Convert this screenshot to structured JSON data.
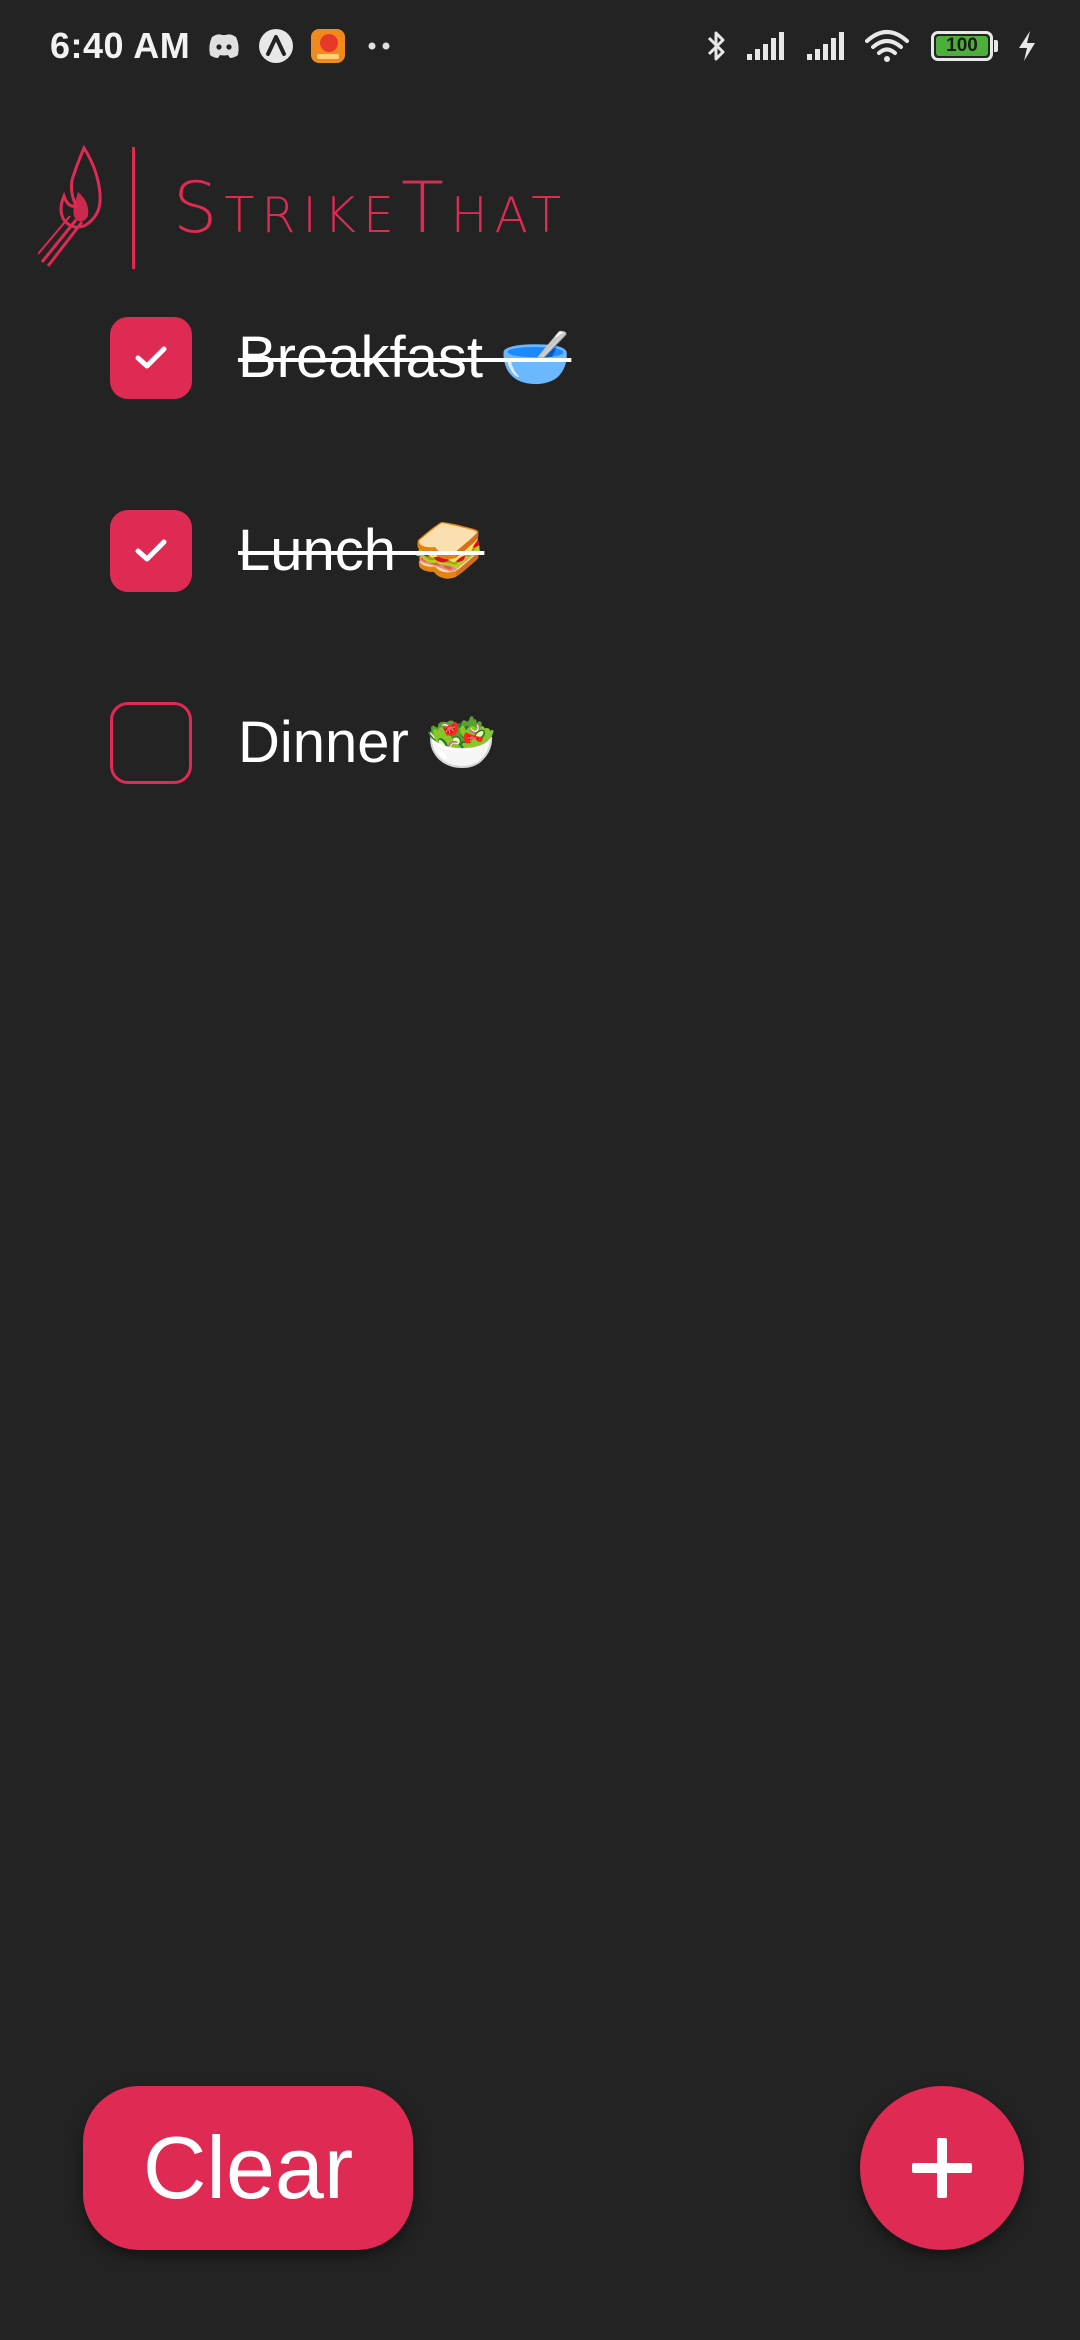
{
  "status_bar": {
    "time": "6:40 AM",
    "left_icons": [
      "discord-icon",
      "arc-icon",
      "app-notification-icon",
      "more-dots-icon"
    ],
    "right_icons": [
      "bluetooth-icon",
      "signal-icon",
      "signal-icon",
      "wifi-icon"
    ],
    "battery_level": "100"
  },
  "app": {
    "name": "StrikeThat",
    "logo_icon": "match-flame-icon",
    "accent_color": "#df2a54",
    "background_color": "#232323"
  },
  "todos": [
    {
      "label": "Breakfast 🥣",
      "checked": true
    },
    {
      "label": "Lunch 🥪",
      "checked": true
    },
    {
      "label": "Dinner 🥗",
      "checked": false
    }
  ],
  "actions": {
    "clear_label": "Clear",
    "add_icon": "plus-icon"
  }
}
